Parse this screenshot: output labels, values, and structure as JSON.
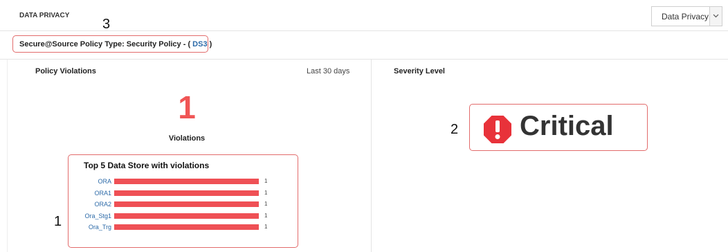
{
  "header": {
    "title": "DATA PRIVACY",
    "dropdown": {
      "selected": "Data Privacy"
    }
  },
  "policy": {
    "prefix": "Secure@Source Policy Type: Security Policy - ( ",
    "link": "DS3",
    "suffix": " )"
  },
  "violations_panel": {
    "title": "Policy Violations",
    "range": "Last 30 days",
    "count": "1",
    "count_label": "Violations"
  },
  "severity_panel": {
    "title": "Severity Level",
    "level": "Critical",
    "icon": "alert-octagon-icon"
  },
  "annotations": {
    "a1": "1",
    "a2": "2",
    "a3": "3"
  },
  "colors": {
    "bar": "#ef5055",
    "count": "#f05555",
    "link": "#2c6aa8",
    "critical_icon": "#e8323a",
    "annotation_border": "#e26b6b"
  },
  "chart_data": {
    "type": "bar",
    "orientation": "horizontal",
    "title": "Top 5 Data Store with violations",
    "categories": [
      "ORA",
      "ORA1",
      "ORA2",
      "Ora_Stg1",
      "Ora_Trg"
    ],
    "values": [
      1,
      1,
      1,
      1,
      1
    ],
    "xlim": [
      0,
      1
    ],
    "grid": false,
    "legend": "none"
  }
}
